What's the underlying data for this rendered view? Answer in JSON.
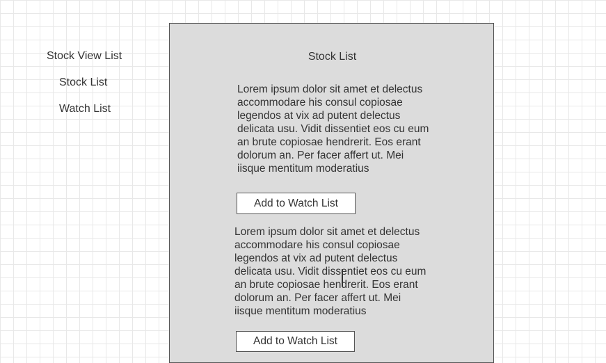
{
  "sidebar": {
    "title": "Stock View List",
    "items": [
      {
        "label": "Stock List"
      },
      {
        "label": "Watch List"
      }
    ]
  },
  "main": {
    "title": "Stock List",
    "stocks": [
      {
        "description": "Lorem ipsum dolor sit amet et delectus accommodare his consul copiosae legendos at vix ad putent delectus delicata usu. Vidit dissentiet eos cu eum an brute copiosae hendrerit. Eos erant dolorum an. Per facer affert ut. Mei iisque mentitum moderatius",
        "button_label": "Add to Watch List"
      },
      {
        "description": "Lorem ipsum dolor sit amet et delectus accommodare his consul copiosae legendos at vix ad putent delectus delicata usu. Vidit dissentiet eos cu eum an brute copiosae hendrerit. Eos erant dolorum an. Per facer affert ut. Mei iisque mentitum moderatius",
        "button_label": "Add to Watch List"
      }
    ]
  },
  "colors": {
    "panel_background": "#dcdcdc",
    "border": "#555555",
    "text": "#333333",
    "grid": "#e8e8e8"
  },
  "icons": {
    "cursor": "text-cursor-icon"
  }
}
